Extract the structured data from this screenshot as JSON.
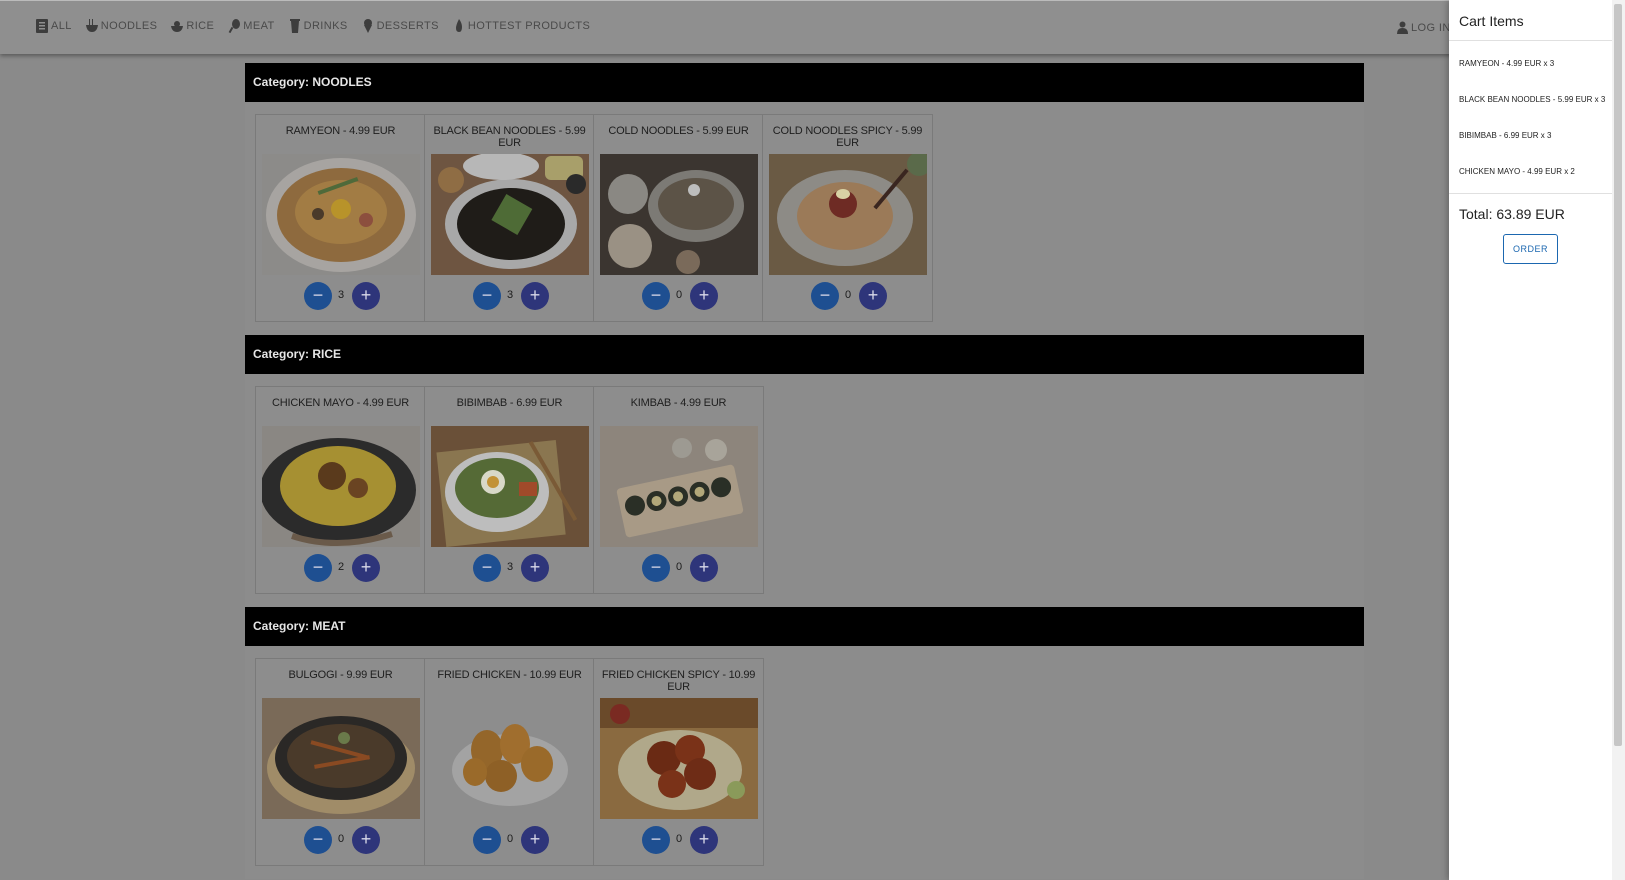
{
  "navbar": {
    "items": [
      {
        "label": "ALL",
        "icon": "menu-book-icon"
      },
      {
        "label": "NOODLES",
        "icon": "noodle-bowl-icon"
      },
      {
        "label": "RICE",
        "icon": "rice-bowl-icon"
      },
      {
        "label": "MEAT",
        "icon": "drumstick-icon"
      },
      {
        "label": "DRINKS",
        "icon": "cup-icon"
      },
      {
        "label": "DESSERTS",
        "icon": "ice-cream-icon"
      },
      {
        "label": "HOTTEST PRODUCTS",
        "icon": "fire-icon"
      }
    ],
    "login": {
      "label": "LOG IN",
      "icon": "user-icon"
    }
  },
  "categories": [
    {
      "header": "Category: NOODLES",
      "products": [
        {
          "title": "RAMYEON - 4.99 EUR",
          "qty": "3"
        },
        {
          "title": "BLACK BEAN NOODLES - 5.99 EUR",
          "qty": "3"
        },
        {
          "title": "COLD NOODLES - 5.99 EUR",
          "qty": "0"
        },
        {
          "title": "COLD NOODLES SPICY - 5.99 EUR",
          "qty": "0"
        }
      ]
    },
    {
      "header": "Category: RICE",
      "products": [
        {
          "title": "CHICKEN MAYO - 4.99 EUR",
          "qty": "2"
        },
        {
          "title": "BIBIMBAB - 6.99 EUR",
          "qty": "3"
        },
        {
          "title": "KIMBAB - 4.99 EUR",
          "qty": "0"
        }
      ]
    },
    {
      "header": "Category: MEAT",
      "products": [
        {
          "title": "BULGOGI - 9.99 EUR",
          "qty": "0"
        },
        {
          "title": "FRIED CHICKEN - 10.99 EUR",
          "qty": "0"
        },
        {
          "title": "FRIED CHICKEN SPICY - 10.99 EUR",
          "qty": "0"
        }
      ]
    }
  ],
  "stepper": {
    "minus": "−",
    "plus": "+"
  },
  "cart": {
    "title": "Cart Items",
    "items": [
      "RAMYEON - 4.99 EUR x 3",
      "BLACK BEAN NOODLES - 5.99 EUR x 3",
      "BIBIMBAB - 6.99 EUR x 3",
      "CHICKEN MAYO - 4.99 EUR x 2"
    ],
    "total": "Total: 63.89 EUR",
    "order_label": "ORDER"
  },
  "colors": {
    "header_bar": "#000000",
    "minus_button": "#1e4f91",
    "plus_button": "#2e357a",
    "order_accent": "#1b67b0"
  }
}
